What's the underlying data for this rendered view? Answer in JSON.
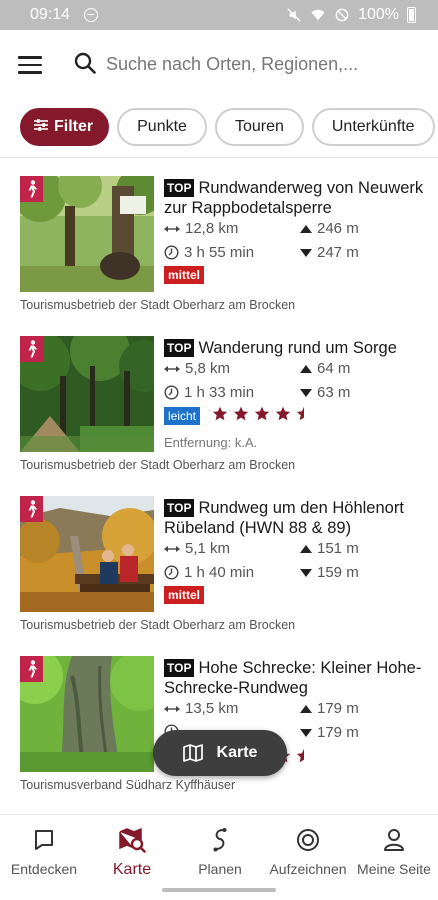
{
  "status_bar": {
    "time": "09:14",
    "battery": "100%"
  },
  "search": {
    "placeholder": "Suche nach Orten, Regionen,..."
  },
  "chips": [
    "Filter",
    "Punkte",
    "Touren",
    "Unterkünfte"
  ],
  "tours": [
    {
      "top": "TOP",
      "title": "Rundwanderweg von Neuwerk zur Rappbodetalsperre",
      "distance": "12,8 km",
      "duration": "3 h 55 min",
      "ascent": "246 m",
      "descent": "247 m",
      "difficulty": "mittel",
      "rating": null,
      "entfernung": null,
      "source": "Tourismusbetrieb der Stadt Oberharz am Brocken"
    },
    {
      "top": "TOP",
      "title": "Wanderung rund um Sorge",
      "distance": "5,8 km",
      "duration": "1 h 33 min",
      "ascent": "64 m",
      "descent": "63 m",
      "difficulty": "leicht",
      "rating": 4.5,
      "entfernung": "Entfernung: k.A.",
      "source": "Tourismusbetrieb der Stadt Oberharz am Brocken"
    },
    {
      "top": "TOP",
      "title": "Rundweg um den Höhlenort Rübeland (HWN 88 & 89)",
      "distance": "5,1 km",
      "duration": "1 h 40 min",
      "ascent": "151 m",
      "descent": "159 m",
      "difficulty": "mittel",
      "rating": null,
      "entfernung": null,
      "source": "Tourismusbetrieb der Stadt Oberharz am Brocken"
    },
    {
      "top": "TOP",
      "title": "Hohe Schrecke: Kleiner Hohe-Schrecke-Rundweg",
      "distance": "13,5 km",
      "duration": "",
      "ascent": "179 m",
      "descent": "179 m",
      "difficulty": "",
      "rating": 4.5,
      "entfernung": null,
      "source": "Tourismusverband Südharz Kyffhäuser"
    }
  ],
  "fab": {
    "label": "Karte"
  },
  "nav": [
    "Entdecken",
    "Karte",
    "Planen",
    "Aufzeichnen",
    "Meine Seite"
  ],
  "colors": {
    "brand": "#84192b",
    "badge_pink": "#c0244b",
    "mittel": "#cc1f1f",
    "leicht": "#1e72c9",
    "star": "#84192b"
  }
}
